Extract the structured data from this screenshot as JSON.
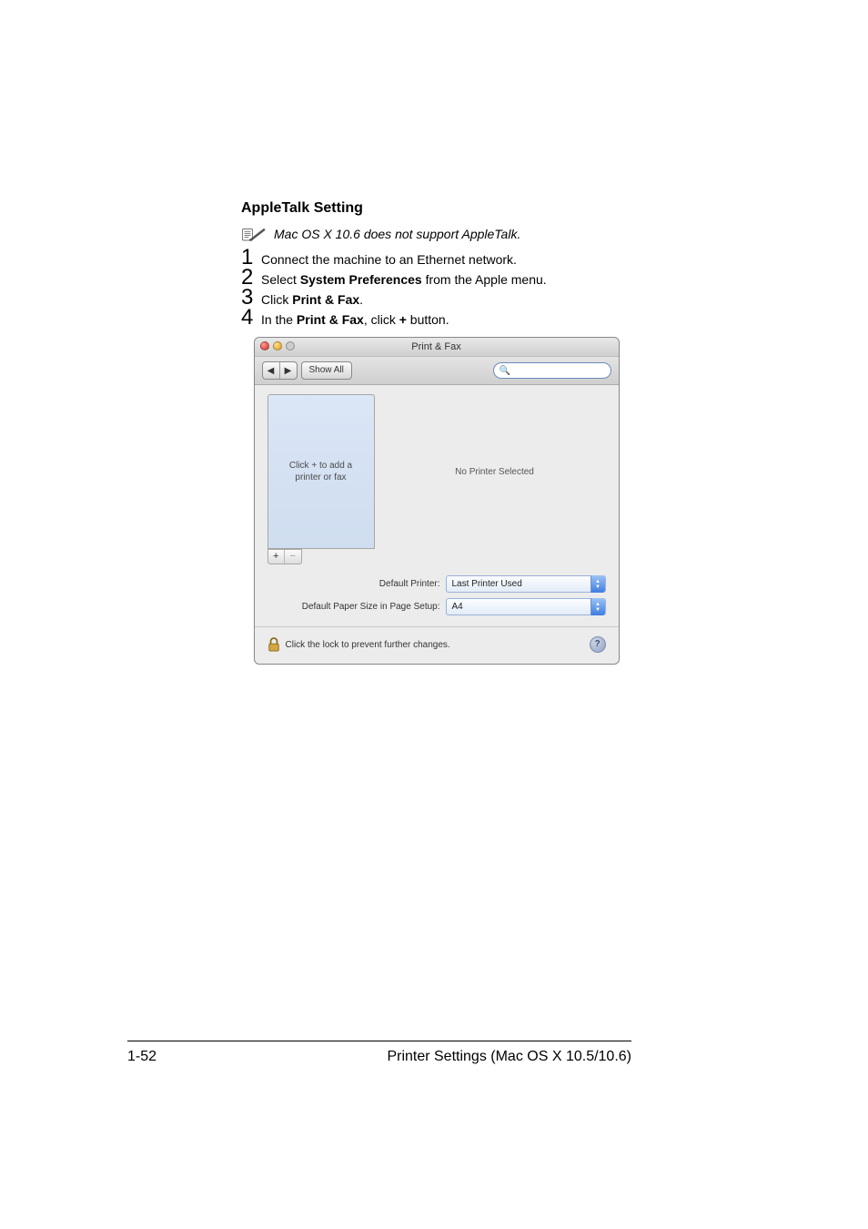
{
  "heading": "AppleTalk Setting",
  "note": "Mac OS X 10.6 does not support AppleTalk.",
  "steps": [
    {
      "num": "1",
      "parts": [
        {
          "t": "Connect the machine to an Ethernet network.",
          "b": false
        }
      ]
    },
    {
      "num": "2",
      "parts": [
        {
          "t": "Select ",
          "b": false
        },
        {
          "t": "System Preferences",
          "b": true
        },
        {
          "t": " from the Apple menu.",
          "b": false
        }
      ]
    },
    {
      "num": "3",
      "parts": [
        {
          "t": "Click ",
          "b": false
        },
        {
          "t": "Print & Fax",
          "b": true
        },
        {
          "t": ".",
          "b": false
        }
      ]
    },
    {
      "num": "4",
      "parts": [
        {
          "t": "In the ",
          "b": false
        },
        {
          "t": "Print & Fax",
          "b": true
        },
        {
          "t": ", click ",
          "b": false
        },
        {
          "t": "+",
          "b": true
        },
        {
          "t": " button.",
          "b": false
        }
      ]
    }
  ],
  "window": {
    "title": "Print & Fax",
    "showAll": "Show All",
    "nav": {
      "back": "◀",
      "fwd": "▶"
    },
    "list_placeholder": "Click + to add a\nprinter or fax",
    "detail_placeholder": "No Printer Selected",
    "add": "+",
    "remove": "−",
    "default_printer_label": "Default Printer:",
    "default_printer_value": "Last Printer Used",
    "default_paper_label": "Default Paper Size in Page Setup:",
    "default_paper_value": "A4",
    "lock_text": "Click the lock to prevent further changes.",
    "help": "?"
  },
  "footer": {
    "left": "1-52",
    "right": "Printer Settings (Mac OS X 10.5/10.6)"
  }
}
